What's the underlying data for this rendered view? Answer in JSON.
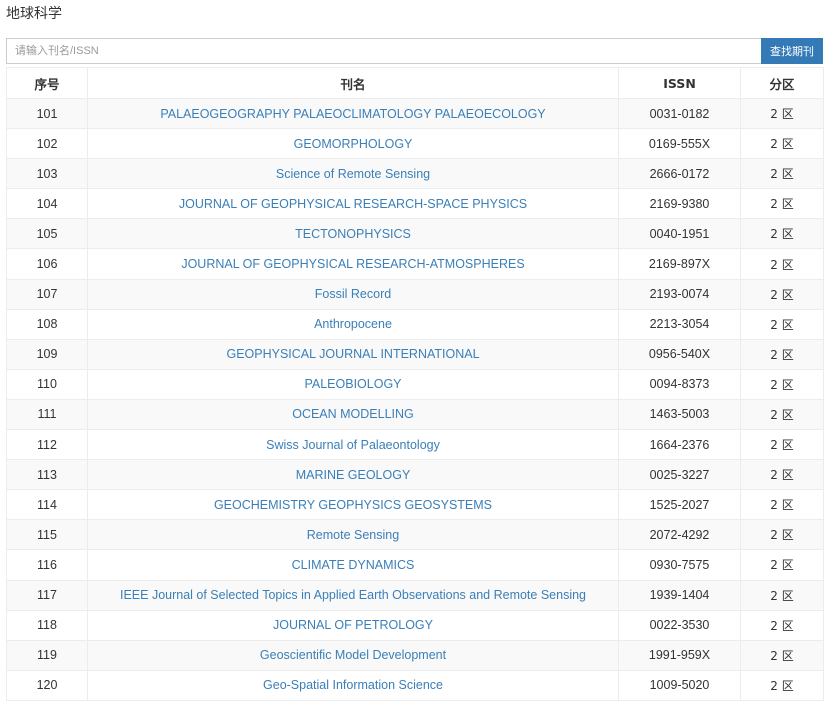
{
  "page": {
    "title": "地球科学"
  },
  "search": {
    "placeholder": "请输入刊名/ISSN",
    "button_label": "查找期刊"
  },
  "table": {
    "headers": {
      "no": "序号",
      "name": "刊名",
      "issn": "ISSN",
      "zone": "分区"
    },
    "rows": [
      {
        "no": "101",
        "name": "PALAEOGEOGRAPHY PALAEOCLIMATOLOGY PALAEOECOLOGY",
        "issn": "0031-0182",
        "zone": "2 区"
      },
      {
        "no": "102",
        "name": "GEOMORPHOLOGY",
        "issn": "0169-555X",
        "zone": "2 区"
      },
      {
        "no": "103",
        "name": "Science of Remote Sensing",
        "issn": "2666-0172",
        "zone": "2 区"
      },
      {
        "no": "104",
        "name": "JOURNAL OF GEOPHYSICAL RESEARCH-SPACE PHYSICS",
        "issn": "2169-9380",
        "zone": "2 区"
      },
      {
        "no": "105",
        "name": "TECTONOPHYSICS",
        "issn": "0040-1951",
        "zone": "2 区"
      },
      {
        "no": "106",
        "name": "JOURNAL OF GEOPHYSICAL RESEARCH-ATMOSPHERES",
        "issn": "2169-897X",
        "zone": "2 区"
      },
      {
        "no": "107",
        "name": "Fossil Record",
        "issn": "2193-0074",
        "zone": "2 区"
      },
      {
        "no": "108",
        "name": "Anthropocene",
        "issn": "2213-3054",
        "zone": "2 区"
      },
      {
        "no": "109",
        "name": "GEOPHYSICAL JOURNAL INTERNATIONAL",
        "issn": "0956-540X",
        "zone": "2 区"
      },
      {
        "no": "110",
        "name": "PALEOBIOLOGY",
        "issn": "0094-8373",
        "zone": "2 区"
      },
      {
        "no": "111",
        "name": "OCEAN MODELLING",
        "issn": "1463-5003",
        "zone": "2 区"
      },
      {
        "no": "112",
        "name": "Swiss Journal of Palaeontology",
        "issn": "1664-2376",
        "zone": "2 区"
      },
      {
        "no": "113",
        "name": "MARINE GEOLOGY",
        "issn": "0025-3227",
        "zone": "2 区"
      },
      {
        "no": "114",
        "name": "GEOCHEMISTRY GEOPHYSICS GEOSYSTEMS",
        "issn": "1525-2027",
        "zone": "2 区"
      },
      {
        "no": "115",
        "name": "Remote Sensing",
        "issn": "2072-4292",
        "zone": "2 区"
      },
      {
        "no": "116",
        "name": "CLIMATE DYNAMICS",
        "issn": "0930-7575",
        "zone": "2 区"
      },
      {
        "no": "117",
        "name": "IEEE Journal of Selected Topics in Applied Earth Observations and Remote Sensing",
        "issn": "1939-1404",
        "zone": "2 区"
      },
      {
        "no": "118",
        "name": "JOURNAL OF PETROLOGY",
        "issn": "0022-3530",
        "zone": "2 区"
      },
      {
        "no": "119",
        "name": "Geoscientific Model Development",
        "issn": "1991-959X",
        "zone": "2 区"
      },
      {
        "no": "120",
        "name": "Geo-Spatial Information Science",
        "issn": "1009-5020",
        "zone": "2 区"
      }
    ]
  },
  "colors": {
    "accent": "#337ab7",
    "link": "#3a7fb8",
    "stripe": "#f9f9f9",
    "border": "#ececec"
  }
}
